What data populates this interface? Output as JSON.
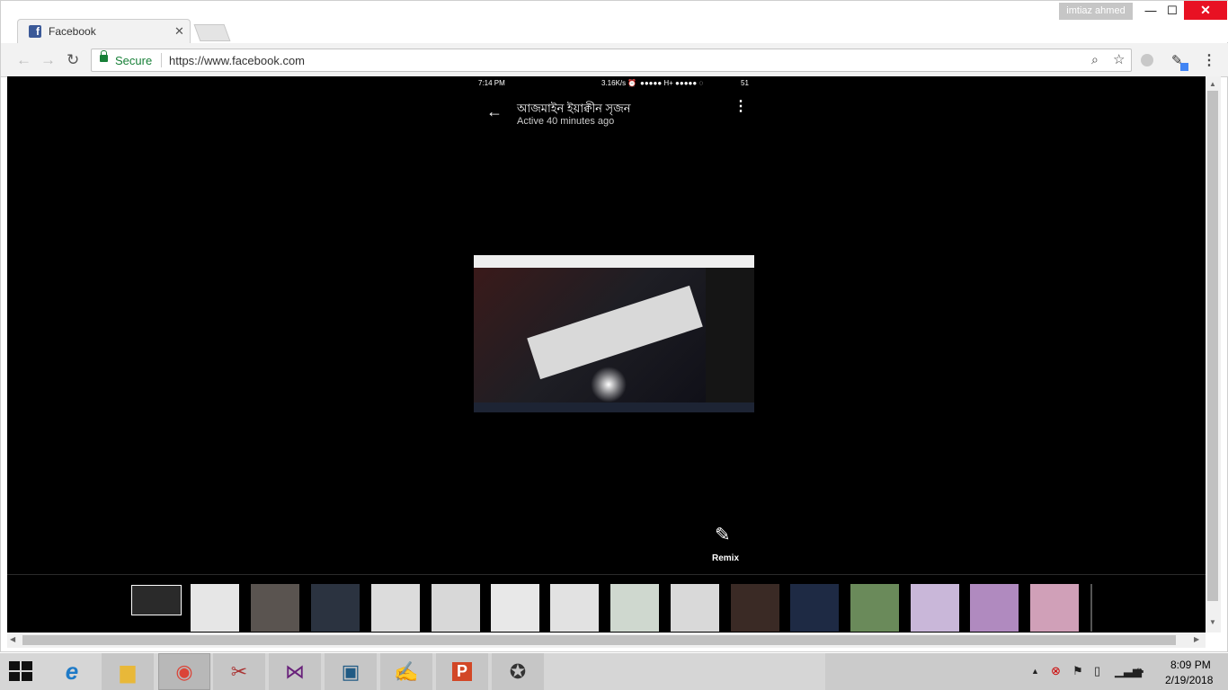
{
  "window": {
    "user": "imtiaz ahmed",
    "close_glyph": "✕",
    "max_glyph": "☐",
    "min_glyph": "—"
  },
  "tab": {
    "title": "Facebook",
    "close_glyph": "✕",
    "favicon": "f"
  },
  "toolbar": {
    "back_glyph": "←",
    "forward_glyph": "→",
    "reload_glyph": "↻",
    "secure_label": "Secure",
    "url": "https://www.facebook.com",
    "zoom_glyph": "⌕",
    "star_glyph": "☆",
    "menu_glyph": "⋮"
  },
  "phone_status": {
    "time": "7:14 PM",
    "speed": "3.16K/s ⏰",
    "signal": "●●●●● H+ ●●●●● ◌",
    "battery": "51"
  },
  "chat": {
    "back_glyph": "←",
    "name": "আজমাইন ইয়াক্বীন সৃজন",
    "status": "Active 40 minutes ago",
    "more_glyph": "⋮"
  },
  "remix": {
    "icon_glyph": "✎",
    "label": "Remix"
  },
  "filmstrip": {
    "thumb_colors": [
      "#2a2a2a",
      "#e6e6e6",
      "#5a5450",
      "#2b3340",
      "#dcdcdc",
      "#d8d8d8",
      "#e8e8e8",
      "#e2e2e2",
      "#cfd8cf",
      "#d9d9d9",
      "#3a2a25",
      "#1e2a44",
      "#6a8a5a",
      "#c9b7d9",
      "#b08abf",
      "#d0a0b8"
    ]
  },
  "scroll": {
    "up": "▲",
    "down": "▼",
    "left": "◀",
    "right": "▶"
  },
  "taskbar": {
    "apps": [
      {
        "name": "ie",
        "glyph": "e",
        "color": "#1e7ac7"
      },
      {
        "name": "explorer",
        "glyph": "▆",
        "color": "#e8b839"
      },
      {
        "name": "chrome",
        "glyph": "◉",
        "color": "#db4437"
      },
      {
        "name": "paint",
        "glyph": "✂",
        "color": "#a33"
      },
      {
        "name": "visual-studio",
        "glyph": "⋈",
        "color": "#68217a"
      },
      {
        "name": "brackets",
        "glyph": "▣",
        "color": "#1f5a84"
      },
      {
        "name": "notepad-plus",
        "glyph": "✍",
        "color": "#3c8c3c"
      },
      {
        "name": "powerpoint",
        "glyph": "P",
        "color": "#d24726"
      },
      {
        "name": "network-app",
        "glyph": "✪",
        "color": "#333"
      }
    ],
    "tray_up": "▲",
    "clock_time": "8:09 PM",
    "clock_date": "2/19/2018"
  }
}
